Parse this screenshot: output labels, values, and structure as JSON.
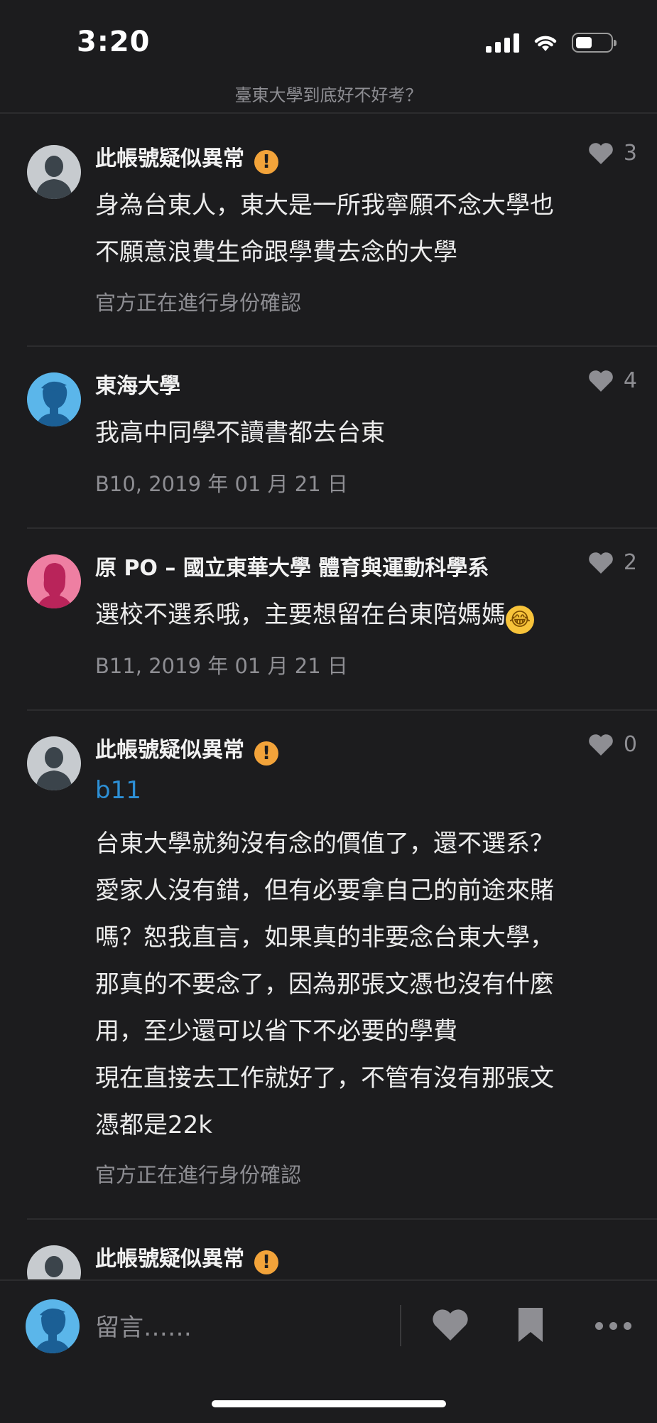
{
  "status_bar": {
    "time": "3:20",
    "battery_level": 0.4
  },
  "page_title": "臺東大學到底好不好考？",
  "comments": [
    {
      "avatar": "default-gray-avatar",
      "username": "此帳號疑似異常",
      "warning_icon": "!",
      "likes": "3",
      "body_lines": [
        "身為台東人，東大是一所我寧願不念大學也",
        "不願意浪費生命跟學費去念的大學"
      ],
      "meta": "官方正在進行身份確認"
    },
    {
      "avatar": "male-blue-avatar",
      "username": "東海大學",
      "likes": "4",
      "body_lines": [
        "我高中同學不讀書都去台東"
      ],
      "meta": "B10, 2019 年 01 月 21 日"
    },
    {
      "avatar": "female-pink-avatar",
      "username": "原 PO – 國立東華大學 體育與運動科學系",
      "likes": "2",
      "body_lines": [
        "選校不選系哦，主要想留在台東陪媽媽"
      ],
      "emoji": "rolling-on-floor-laughing-emoji",
      "meta": "B11, 2019 年 01 月 21 日"
    },
    {
      "avatar": "default-gray-avatar",
      "username": "此帳號疑似異常",
      "warning_icon": "!",
      "likes": "0",
      "reply_to": "b11",
      "body_lines": [
        "台東大學就夠沒有念的價值了，還不選系？",
        "愛家人沒有錯，但有必要拿自己的前途來賭",
        "嗎？恕我直言，如果真的非要念台東大學，",
        "那真的不要念了，因為那張文憑也沒有什麼",
        "用，至少還可以省下不必要的學費",
        "現在直接去工作就好了，不管有沒有那張文",
        "憑都是22k"
      ],
      "meta": "官方正在進行身份確認"
    },
    {
      "avatar": "default-gray-avatar",
      "username": "此帳號疑似異常",
      "warning_icon": "!"
    }
  ],
  "bottom_bar": {
    "avatar": "male-blue-avatar",
    "input_placeholder": "留言……",
    "icons": [
      "heart-icon",
      "bookmark-icon",
      "more-icon"
    ]
  },
  "colors": {
    "background": "#1c1c1e",
    "reply_tag": "#2d8fd5",
    "warning": "#f2a33a",
    "muted": "#8e8e93"
  }
}
